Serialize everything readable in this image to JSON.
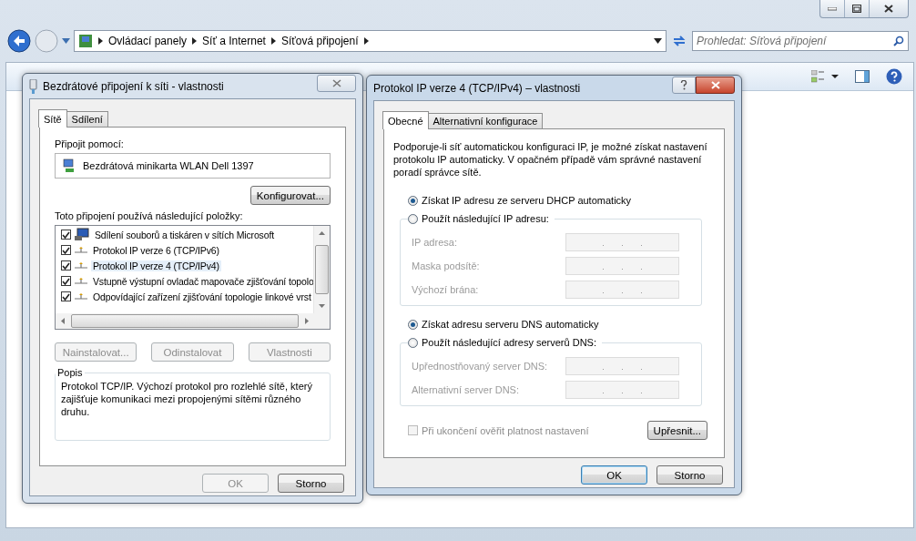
{
  "explorer": {
    "breadcrumb": [
      "Ovládací panely",
      "Síť a Internet",
      "Síťová připojení"
    ],
    "search": {
      "placeholder": "Prohledat: Síťová připojení"
    }
  },
  "dialog1": {
    "title": "Bezdrátové připojení k síti - vlastnosti",
    "tabs": [
      {
        "label": "Sítě",
        "selected": true
      },
      {
        "label": "Sdílení",
        "selected": false
      }
    ],
    "connect_label": "Připojit pomocí:",
    "adapter": "Bezdrátová minikarta WLAN Dell 1397",
    "configure_button": "Konfigurovat...",
    "items_label": "Toto připojení používá následující položky:",
    "items": [
      {
        "label": "Sdílení souborů a tiskáren v sítích Microsoft",
        "kind": "service",
        "checked": true,
        "selected": false
      },
      {
        "label": "Protokol IP verze 6 (TCP/IPv6)",
        "kind": "protocol",
        "checked": true,
        "selected": false
      },
      {
        "label": "Protokol IP verze 4 (TCP/IPv4)",
        "kind": "protocol",
        "checked": true,
        "selected": true
      },
      {
        "label": "Vstupně výstupní ovladač mapovače zjišťování topolo",
        "kind": "protocol",
        "checked": true,
        "selected": false
      },
      {
        "label": "Odpovídající zařízení zjišťování topologie linkové vrst",
        "kind": "protocol",
        "checked": true,
        "selected": false
      }
    ],
    "buttons": [
      {
        "label": "Nainstalovat...",
        "disabled": true
      },
      {
        "label": "Odinstalovat",
        "disabled": true
      },
      {
        "label": "Vlastnosti",
        "disabled": true
      }
    ],
    "description": {
      "title": "Popis",
      "text": "Protokol TCP/IP. Výchozí protokol pro rozlehlé sítě, který zajišťuje komunikaci mezi propojenými sítěmi různého druhu."
    },
    "footer_buttons": [
      {
        "label": "OK",
        "disabled": true
      },
      {
        "label": "Storno",
        "disabled": false
      }
    ]
  },
  "dialog2": {
    "title": "Protokol IP verze 4 (TCP/IPv4) – vlastnosti",
    "tabs": [
      {
        "label": "Obecné",
        "selected": true
      },
      {
        "label": "Alternativní konfigurace",
        "selected": false
      }
    ],
    "intro": "Podporuje-li síť automatickou konfiguraci IP, je možné získat nastavení protokolu IP automaticky. V opačném případě vám správné nastavení poradí správce sítě.",
    "ip_mode": [
      {
        "label": "Získat IP adresu ze serveru DHCP automaticky",
        "selected": true
      },
      {
        "label": "Použít následující IP adresu:",
        "selected": false
      }
    ],
    "ip_fields": [
      {
        "label": "IP adresa:",
        "disabled": true
      },
      {
        "label": "Maska podsítě:",
        "disabled": true
      },
      {
        "label": "Výchozí brána:",
        "disabled": true
      }
    ],
    "dns_mode": [
      {
        "label": "Získat adresu serveru DNS automaticky",
        "selected": true
      },
      {
        "label": "Použít následující adresy serverů DNS:",
        "selected": false
      }
    ],
    "dns_fields": [
      {
        "label": "Upřednostňovaný server DNS:",
        "disabled": true
      },
      {
        "label": "Alternativní server DNS:",
        "disabled": true
      }
    ],
    "validate": {
      "label": "Při ukončení ověřit platnost nastavení",
      "checked": false,
      "disabled": true
    },
    "advanced_button": "Upřesnit...",
    "footer_buttons": [
      {
        "label": "OK",
        "default": true
      },
      {
        "label": "Storno",
        "default": false
      }
    ]
  }
}
